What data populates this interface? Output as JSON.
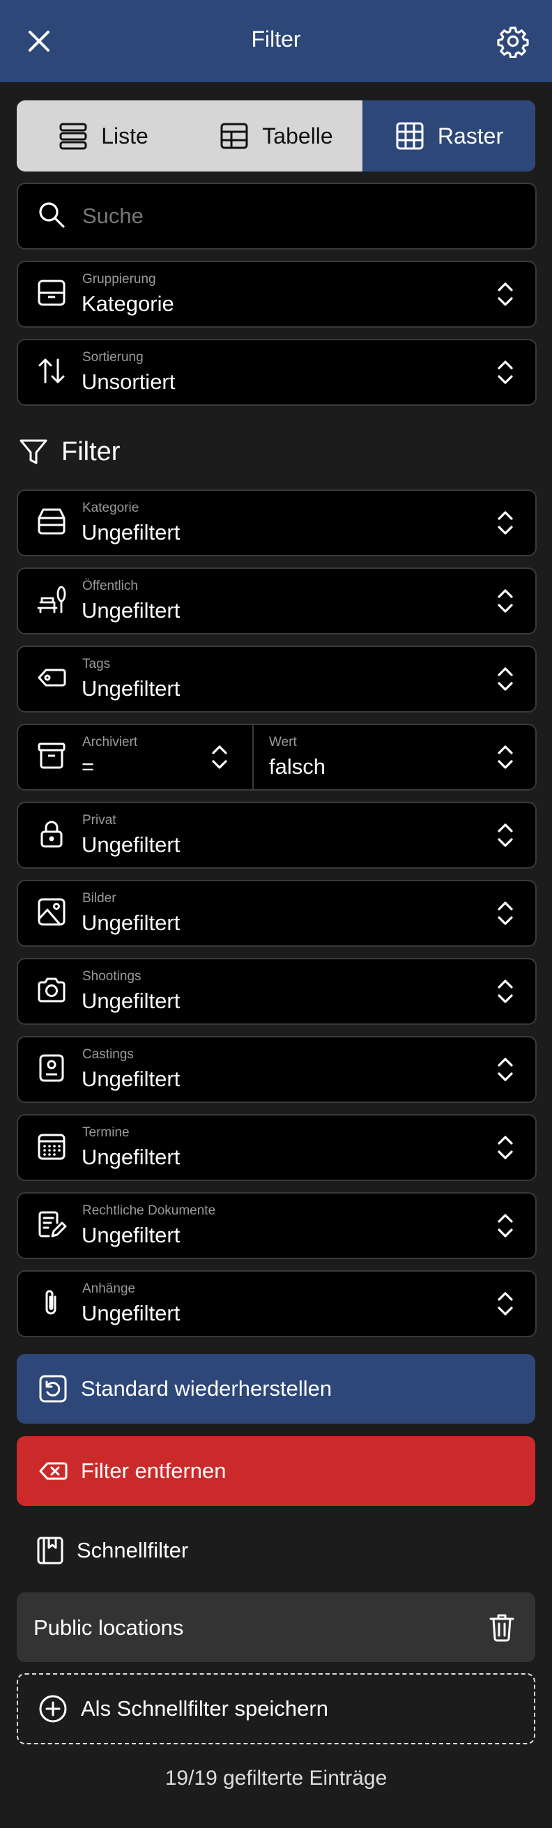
{
  "header": {
    "title": "Filter",
    "close_icon": "close-icon",
    "settings_icon": "gear-icon"
  },
  "view_modes": [
    {
      "label": "Liste",
      "icon": "list-icon",
      "selected": false
    },
    {
      "label": "Tabelle",
      "icon": "table-icon",
      "selected": false
    },
    {
      "label": "Raster",
      "icon": "grid-icon",
      "selected": true
    }
  ],
  "search": {
    "placeholder": "Suche"
  },
  "grouping": {
    "label": "Gruppierung",
    "value": "Kategorie"
  },
  "sorting": {
    "label": "Sortierung",
    "value": "Unsortiert"
  },
  "filter_section": {
    "title": "Filter"
  },
  "filters": [
    {
      "label": "Kategorie",
      "value": "Ungefiltert",
      "icon": "inbox-icon"
    },
    {
      "label": "Öffentlich",
      "value": "Ungefiltert",
      "icon": "park-bench-icon"
    },
    {
      "label": "Tags",
      "value": "Ungefiltert",
      "icon": "tag-icon"
    }
  ],
  "archived": {
    "label": "Archiviert",
    "operator": "=",
    "value_label": "Wert",
    "value": "falsch"
  },
  "filters2": [
    {
      "label": "Privat",
      "value": "Ungefiltert",
      "icon": "lock-icon"
    },
    {
      "label": "Bilder",
      "value": "Ungefiltert",
      "icon": "image-icon"
    },
    {
      "label": "Shootings",
      "value": "Ungefiltert",
      "icon": "camera-icon"
    },
    {
      "label": "Castings",
      "value": "Ungefiltert",
      "icon": "id-card-icon"
    },
    {
      "label": "Termine",
      "value": "Ungefiltert",
      "icon": "calendar-icon"
    },
    {
      "label": "Rechtliche Dokumente",
      "value": "Ungefiltert",
      "icon": "document-edit-icon"
    },
    {
      "label": "Anhänge",
      "value": "Ungefiltert",
      "icon": "paperclip-icon"
    }
  ],
  "actions": {
    "restore": "Standard wiederherstellen",
    "remove": "Filter entfernen"
  },
  "quick_filters": {
    "title": "Schnellfilter",
    "items": [
      "Public locations"
    ],
    "save_label": "Als Schnellfilter speichern"
  },
  "footer": {
    "count_text": "19/19 gefilterte Einträge"
  },
  "colors": {
    "accent": "#2d4778",
    "danger": "#cc2a2a",
    "background": "#1c1c1c",
    "field": "#000000"
  }
}
